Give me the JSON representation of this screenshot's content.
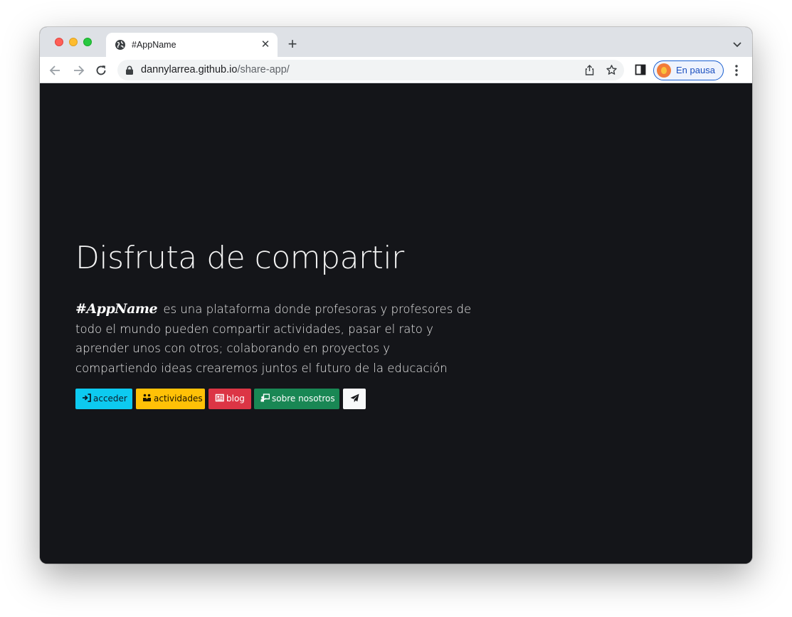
{
  "browser": {
    "tab_title": "#AppName",
    "url_host": "dannylarrea.github.io",
    "url_path": "/share-app/",
    "profile_label": "En pausa"
  },
  "page": {
    "heading": "Disfruta de compartir",
    "brand": "#AppName",
    "description": "es una plataforma donde profesoras y profesores de todo el mundo pueden compartir actividades, pasar el rato y aprender unos con otros; colaborando en proyectos y compartiendo ideas crearemos juntos el futuro de la educación",
    "buttons": {
      "acceder": "acceder",
      "actividades": "actividades",
      "blog": "blog",
      "nosotros": "sobre nosotros"
    }
  },
  "colors": {
    "page_background": "#141519",
    "acceder": "#0dcaf0",
    "actividades": "#ffc107",
    "blog": "#dc3545",
    "nosotros": "#198754",
    "send": "#f8f9fa"
  },
  "icons": [
    "globe-icon",
    "close-icon",
    "plus-icon",
    "chevron-down-icon",
    "back-arrow-icon",
    "forward-arrow-icon",
    "reload-icon",
    "lock-icon",
    "share-icon",
    "star-icon",
    "side-panel-icon",
    "kebab-menu-icon",
    "sign-in-icon",
    "users-icon",
    "newspaper-icon",
    "chalkboard-teacher-icon",
    "paper-plane-icon"
  ]
}
